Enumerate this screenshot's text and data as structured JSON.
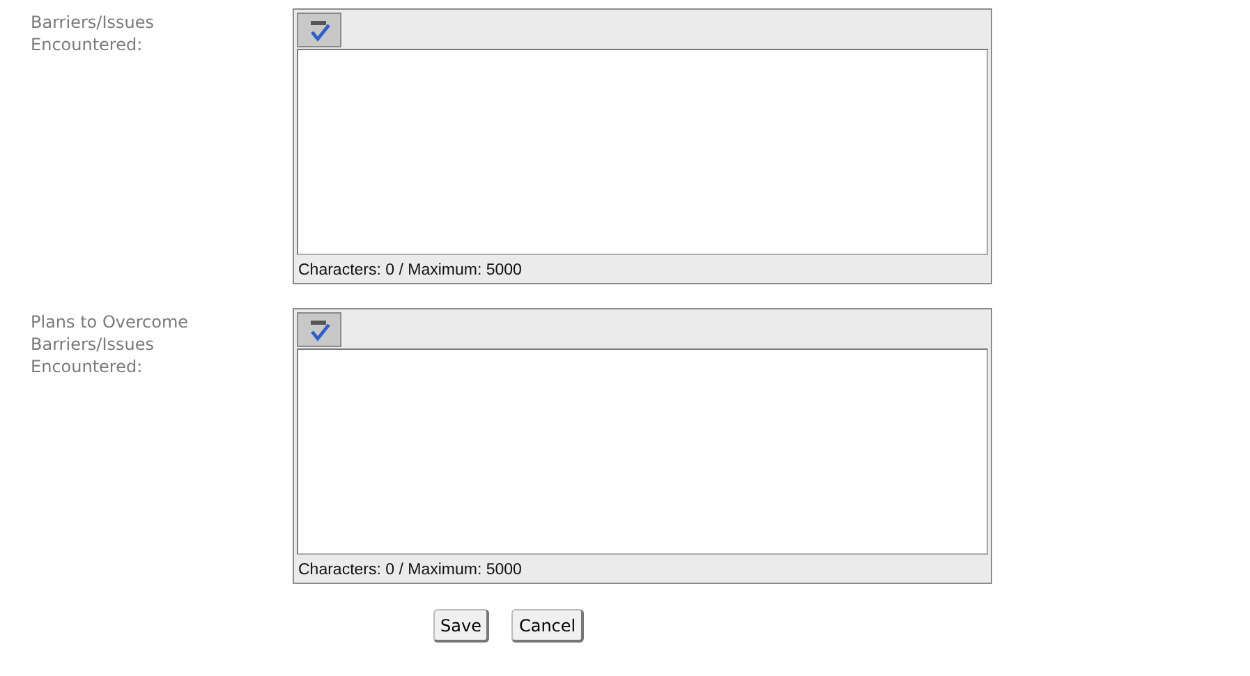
{
  "fields": [
    {
      "label": "Barriers/Issues Encountered:",
      "counter": "Characters: 0 / Maximum: 5000"
    },
    {
      "label": "Plans to Overcome Barriers/Issues Encountered:",
      "counter": "Characters: 0 / Maximum: 5000"
    }
  ],
  "buttons": [
    "Save",
    "Cancel"
  ]
}
